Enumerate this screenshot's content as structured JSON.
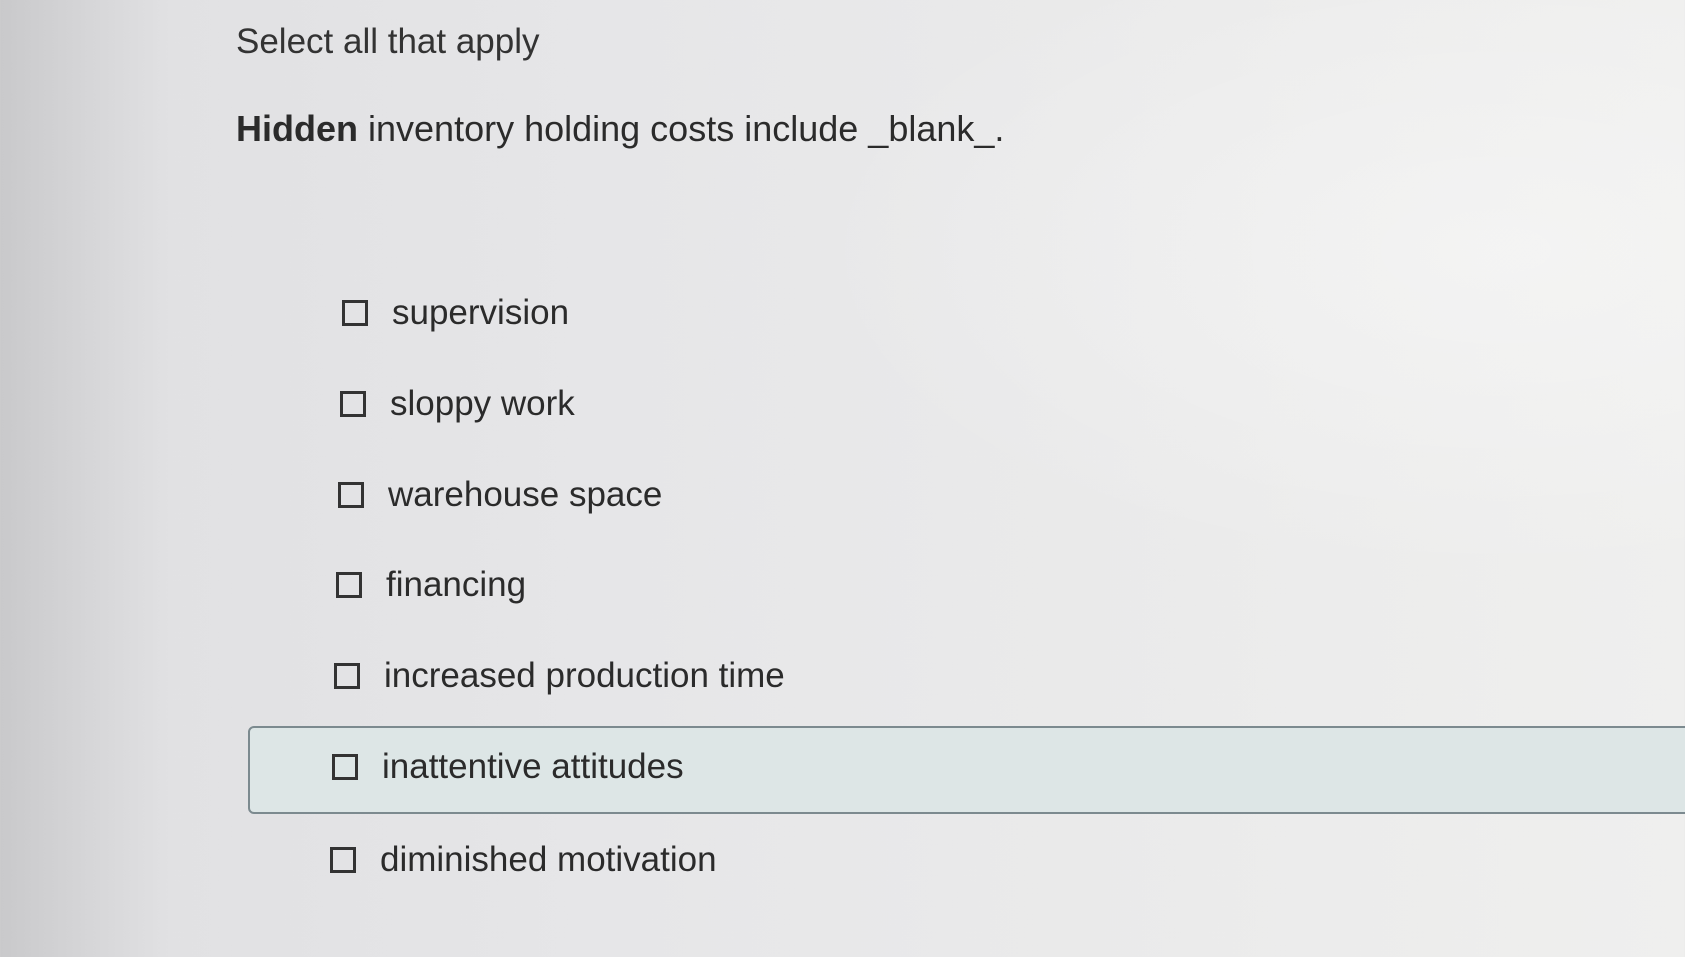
{
  "instruction": "Select all that apply",
  "question": {
    "bold": "Hidden",
    "rest": " inventory holding costs include _blank_."
  },
  "options": [
    {
      "label": "supervision",
      "checked": false
    },
    {
      "label": "sloppy work",
      "checked": false
    },
    {
      "label": "warehouse space",
      "checked": false
    },
    {
      "label": "financing",
      "checked": false
    },
    {
      "label": "increased production time",
      "checked": false
    },
    {
      "label": "inattentive attitudes",
      "checked": false,
      "focused": true
    },
    {
      "label": "diminished motivation",
      "checked": false
    }
  ],
  "colors": {
    "focus_border": "#7c8a8f",
    "focus_fill": "#dde6e6",
    "text": "#2b2b2b"
  }
}
